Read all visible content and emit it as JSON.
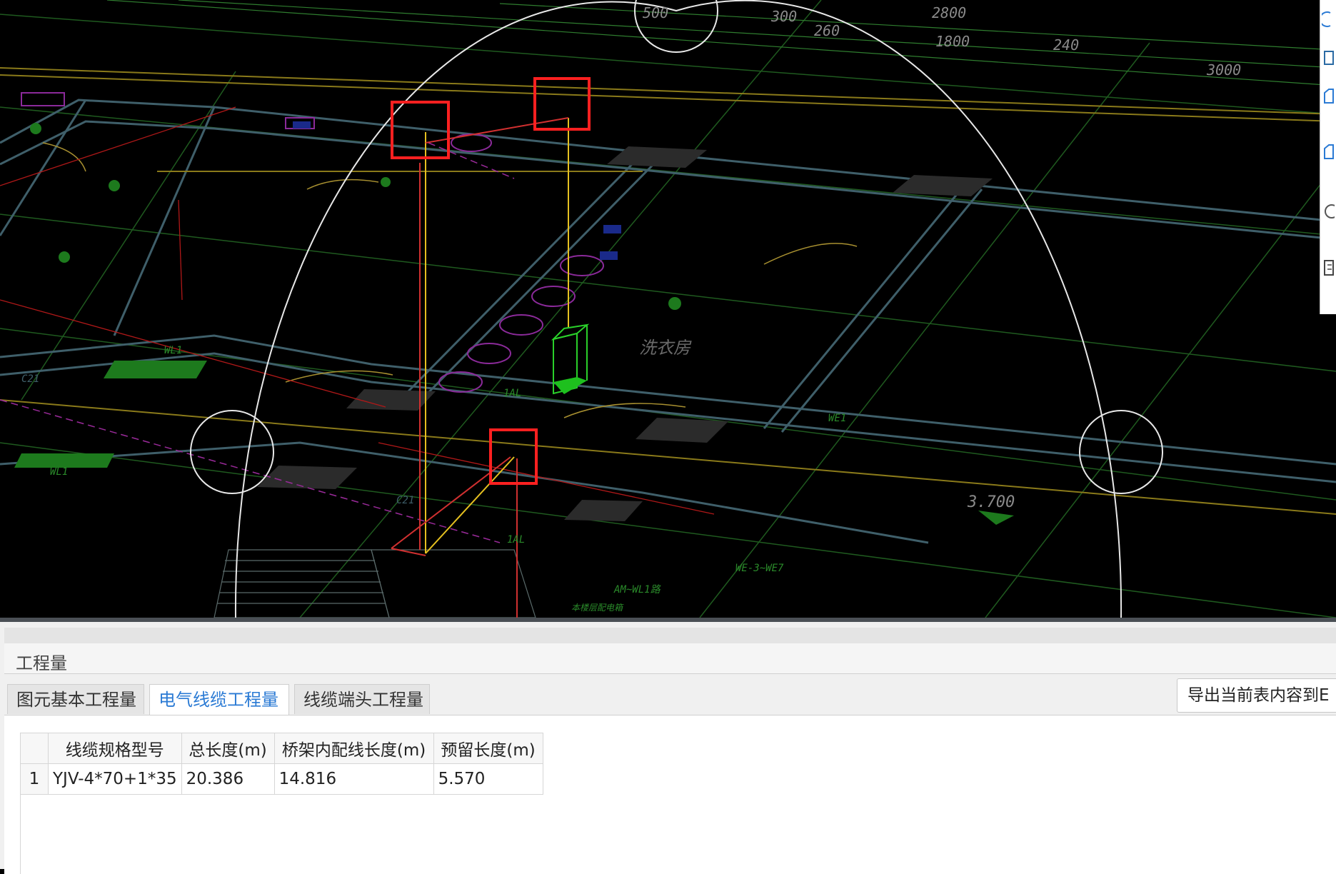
{
  "drawing": {
    "dimension_labels": [
      "500",
      "300",
      "260",
      "2800",
      "1800",
      "240",
      "3000"
    ],
    "room_labels": [
      "洗衣房"
    ],
    "distribution_box_labels": [
      "1AL",
      "1AL"
    ],
    "wire_labels": [
      "WL1",
      "WL1",
      "WE1",
      "C21",
      "C21"
    ],
    "level_mark": "3.700",
    "circuit_labels": [
      "WE-3~WE7",
      "AM~WL1路",
      "本楼层配电箱"
    ],
    "highlight_color": "#ff2020",
    "background_color": "#000000"
  },
  "panel": {
    "title": "工程量",
    "tabs": [
      {
        "label": "图元基本工程量",
        "active": false
      },
      {
        "label": "电气线缆工程量",
        "active": true
      },
      {
        "label": "线缆端头工程量",
        "active": false
      }
    ],
    "export_label": "导出当前表内容到E",
    "table": {
      "headers": [
        "",
        "线缆规格型号",
        "总长度(m)",
        "桥架内配线长度(m)",
        "预留长度(m)"
      ],
      "rows": [
        {
          "index": "1",
          "spec": "YJV-4*70+1*35",
          "total_length": "20.386",
          "tray_length": "14.816",
          "reserved_length": "5.570"
        }
      ]
    }
  }
}
